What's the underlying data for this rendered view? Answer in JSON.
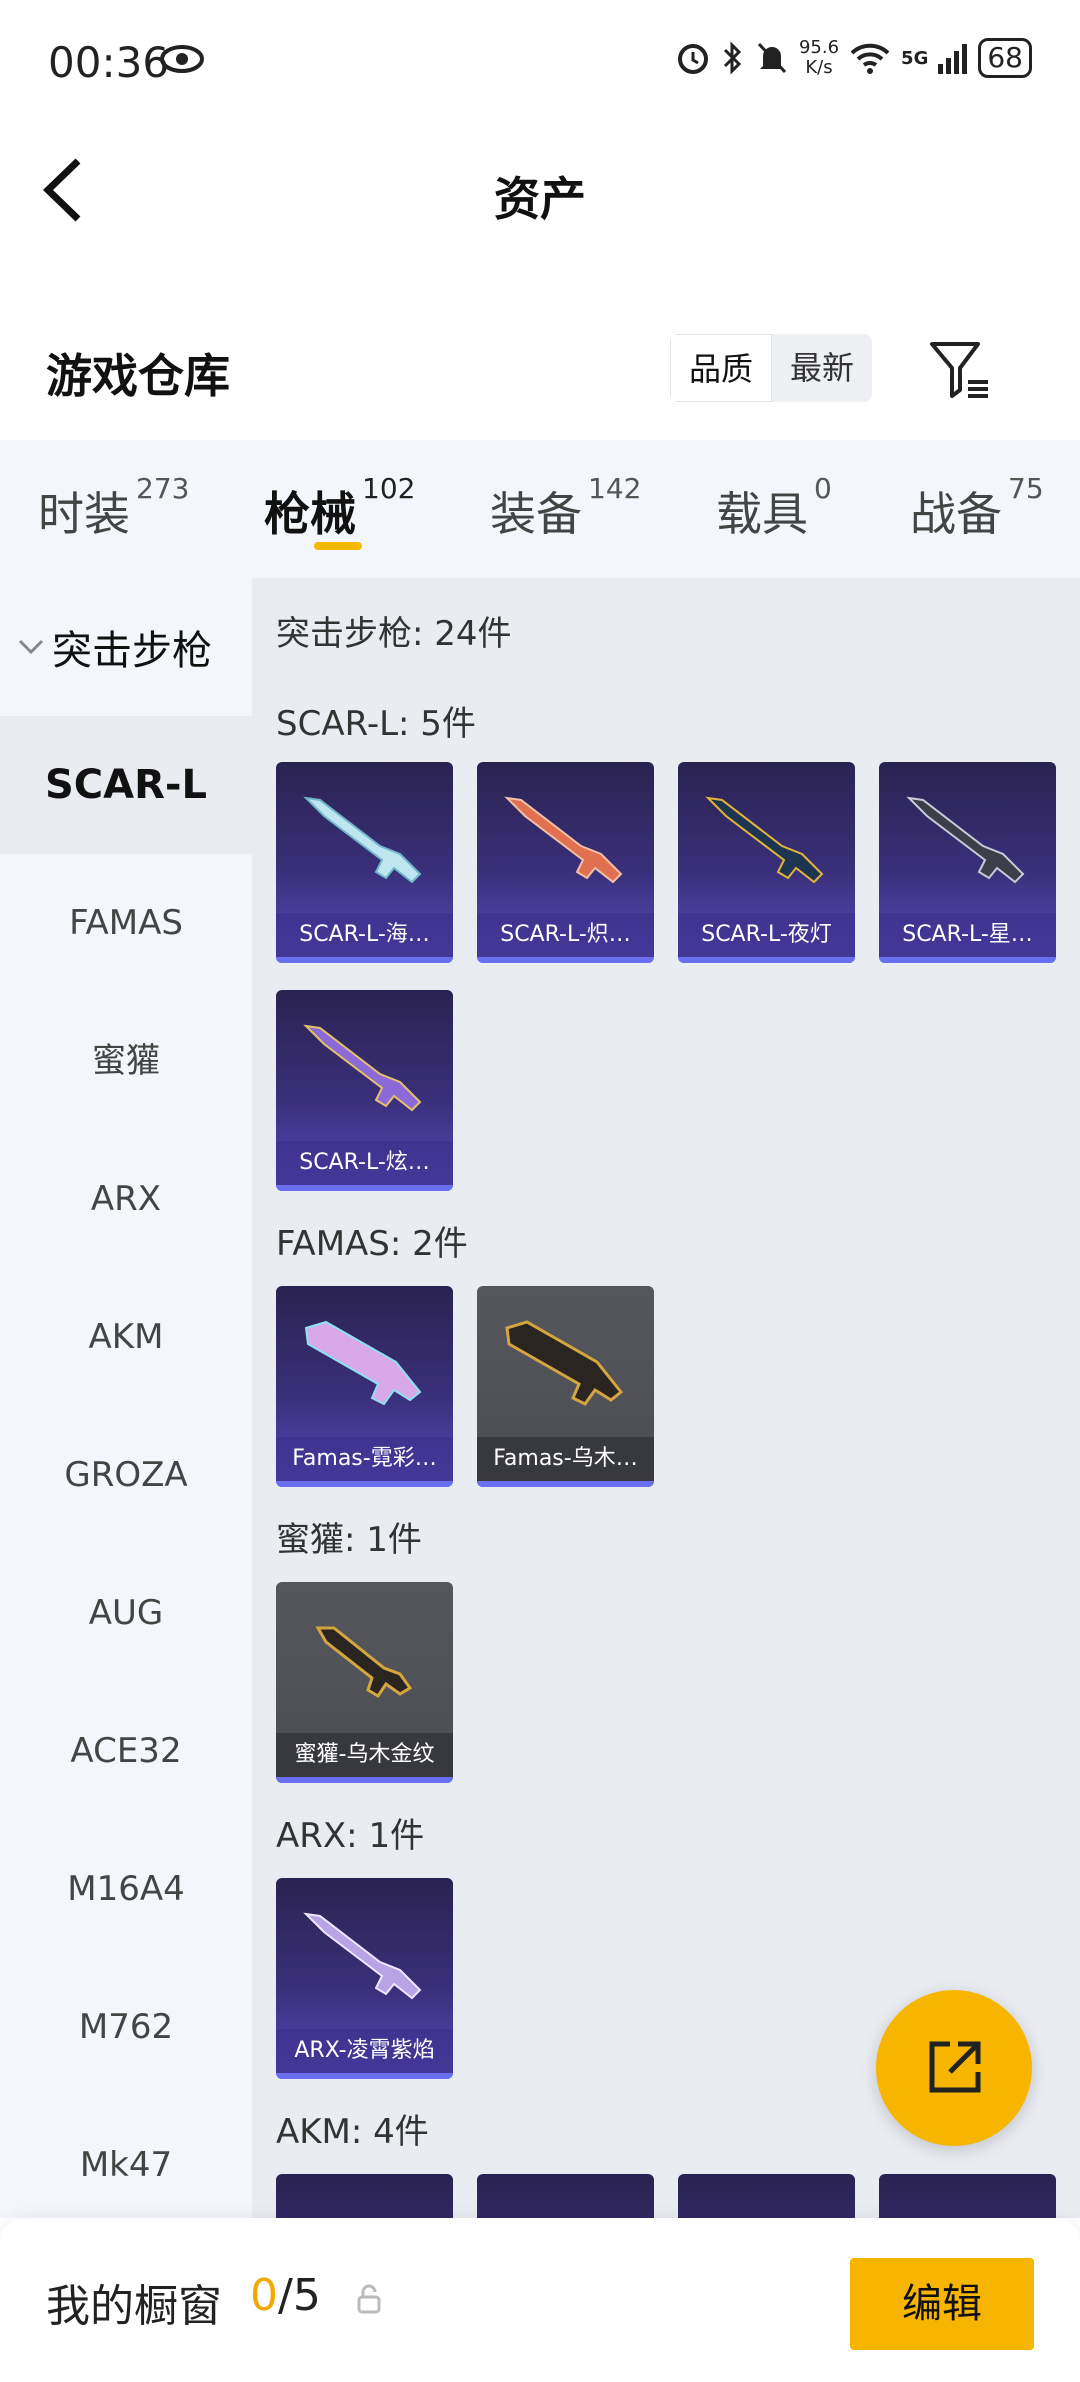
{
  "status_bar": {
    "time": "00:36",
    "net_speed_value": "95.6",
    "net_speed_unit": "K/s",
    "signal": "5G",
    "battery": "68"
  },
  "nav": {
    "title": "资产"
  },
  "warehouse": {
    "title": "游戏仓库",
    "sort_options": [
      {
        "label": "品质",
        "active": true
      },
      {
        "label": "最新",
        "active": false
      }
    ]
  },
  "tabs": [
    {
      "label": "时装",
      "count": "273"
    },
    {
      "label": "枪械",
      "count": "102",
      "active": true
    },
    {
      "label": "装备",
      "count": "142"
    },
    {
      "label": "载具",
      "count": "0"
    },
    {
      "label": "战备",
      "count": "75"
    }
  ],
  "sidebar": {
    "category": "突击步枪",
    "items": [
      "SCAR-L",
      "FAMAS",
      "蜜獾",
      "ARX",
      "AKM",
      "GROZA",
      "AUG",
      "ACE32",
      "M16A4",
      "M762",
      "Mk47"
    ],
    "selected": "SCAR-L"
  },
  "content": {
    "category_summary": "突击步枪: 24件",
    "groups": [
      {
        "title": "SCAR-L: 5件",
        "items": [
          "SCAR-L-海…",
          "SCAR-L-炽…",
          "SCAR-L-夜灯",
          "SCAR-L-星…",
          "SCAR-L-炫…"
        ]
      },
      {
        "title": "FAMAS: 2件",
        "items": [
          "Famas-霓彩…",
          "Famas-乌木…"
        ]
      },
      {
        "title": "蜜獾: 1件",
        "items": [
          "蜜獾-乌木金纹"
        ]
      },
      {
        "title": "ARX: 1件",
        "items": [
          "ARX-凌霄紫焰"
        ]
      },
      {
        "title": "AKM: 4件",
        "items": []
      }
    ]
  },
  "bottom_bar": {
    "title": "我的橱窗",
    "count_current": "0",
    "count_total": "/5",
    "edit_label": "编辑"
  },
  "colors": {
    "accent": "#f7b500",
    "purple_card": "#3a2f7a",
    "grey_card": "#505259"
  }
}
